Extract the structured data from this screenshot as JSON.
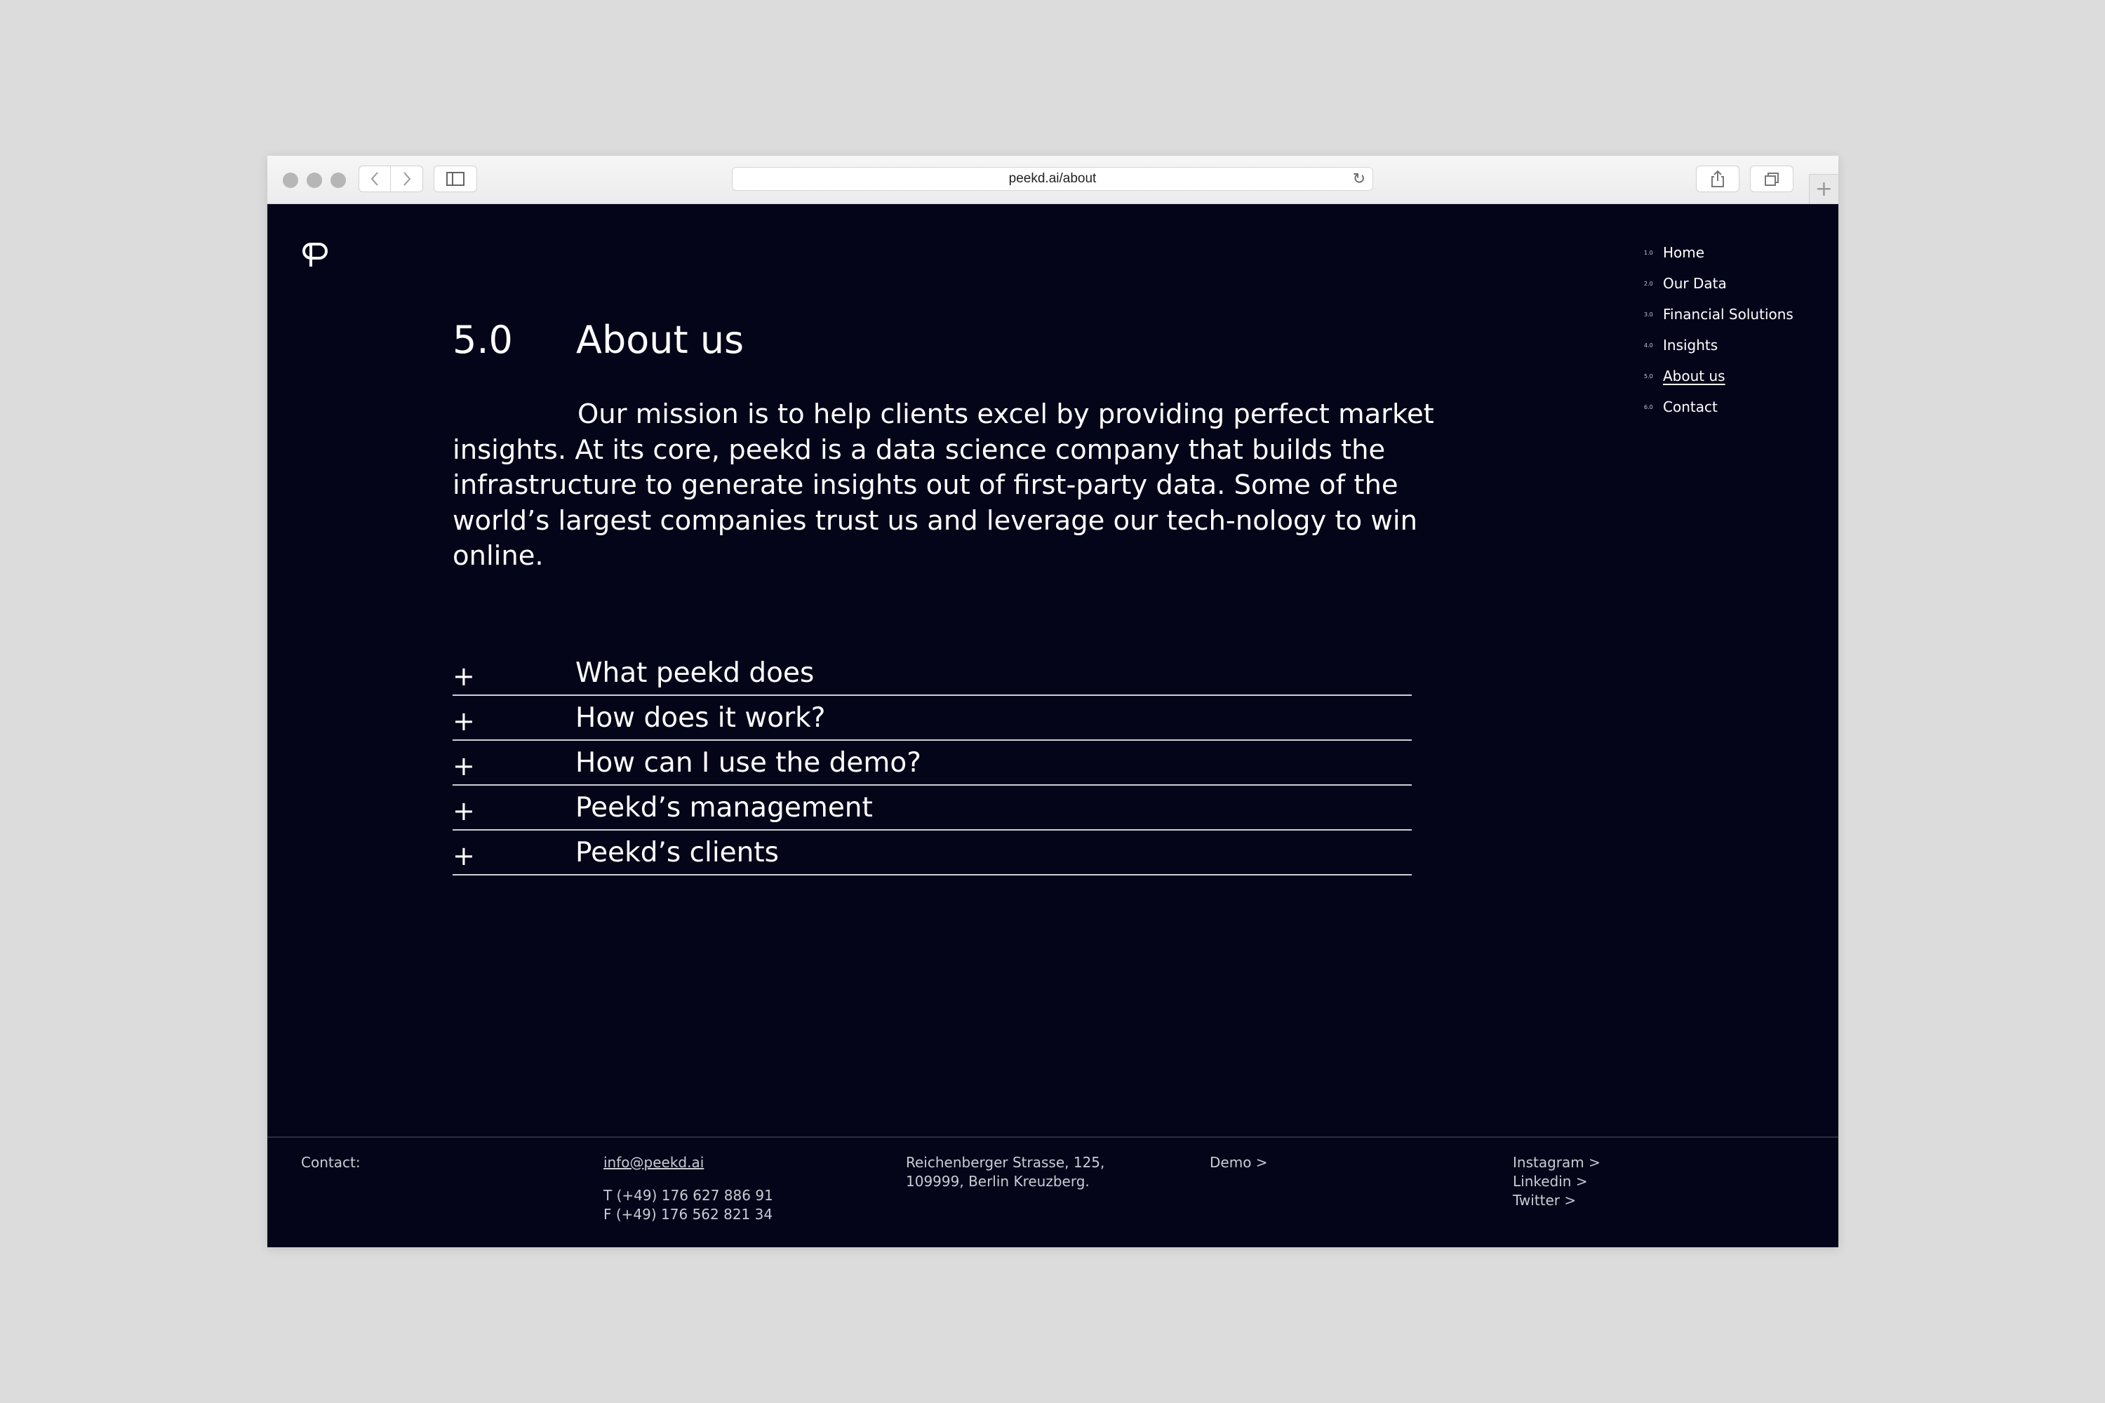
{
  "browser": {
    "url": "peekd.ai/about"
  },
  "nav": {
    "items": [
      {
        "num": "1.0",
        "label": "Home"
      },
      {
        "num": "2.0",
        "label": "Our Data"
      },
      {
        "num": "3.0",
        "label": "Financial Solutions"
      },
      {
        "num": "4.0",
        "label": "Insights"
      },
      {
        "num": "5.0",
        "label": "About us"
      },
      {
        "num": "6.0",
        "label": "Contact"
      }
    ]
  },
  "page": {
    "section_number": "5.0",
    "title": "About us",
    "mission": "Our mission is to help clients excel by providing perfect market insights. At its core, peekd is a data science company that builds the infrastructure to generate insights out of first-party data. Some of the world’s largest companies trust us and leverage our tech-nology to win online."
  },
  "accordion": {
    "plus_symbol": "+",
    "items": [
      "What peekd does",
      "How does it work?",
      "How can I use the demo?",
      "Peekd’s management",
      "Peekd’s clients"
    ]
  },
  "footer": {
    "contact_label": "Contact:",
    "email": "info@peekd.ai",
    "phone": "T (+49) 176 627 886 91",
    "fax": "F (+49) 176 562 821 34",
    "address_line1": "Reichenberger Strasse, 125,",
    "address_line2": "109999, Berlin Kreuzberg.",
    "demo_link": "Demo >",
    "social": [
      "Instagram >",
      "Linkedin >",
      "Twitter >"
    ]
  },
  "icons": {
    "logo": "peekd-logo-icon",
    "back": "chevron-left-icon",
    "forward": "chevron-right-icon",
    "sidebar": "sidebar-icon",
    "reload": "reload-icon",
    "share": "share-icon",
    "tabs": "tabs-icon",
    "new_tab": "plus-icon"
  },
  "colors": {
    "page_background": "#05051a",
    "text": "#ffffff",
    "divider": "#cfcfd8"
  }
}
